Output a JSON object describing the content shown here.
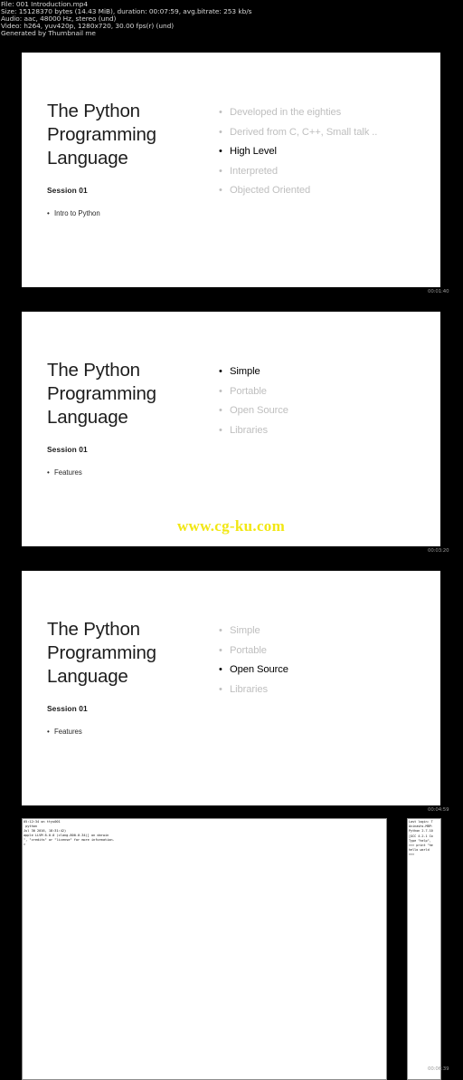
{
  "header": {
    "lines": [
      "File: 001 Introduction.mp4",
      "Size: 15128370 bytes (14.43 MiB), duration: 00:07:59, avg.bitrate: 253 kb/s",
      "Audio: aac, 48000 Hz, stereo (und)",
      "Video: h264, yuv420p, 1280x720, 30.00 fps(r) (und)",
      "Generated by Thumbnail me"
    ]
  },
  "thumbnails": [
    {
      "timestamp": "00:01:40",
      "title": "The Python Programming Language",
      "session": "Session 01",
      "subbullet": "Intro to Python",
      "bullets": [
        {
          "label": "Developed in the eighties",
          "active": false
        },
        {
          "label": "Derived from C, C++, Small talk ..",
          "active": false
        },
        {
          "label": "High Level",
          "active": true
        },
        {
          "label": "Interpreted",
          "active": false
        },
        {
          "label": "Objected Oriented",
          "active": false
        }
      ],
      "watermark": ""
    },
    {
      "timestamp": "00:03:20",
      "title": "The Python Programming Language",
      "session": "Session 01",
      "subbullet": "Features",
      "bullets": [
        {
          "label": "Simple",
          "active": true
        },
        {
          "label": "Portable",
          "active": false
        },
        {
          "label": "Open Source",
          "active": false
        },
        {
          "label": "Libraries",
          "active": false
        }
      ],
      "watermark": "www.cg-ku.com"
    },
    {
      "timestamp": "00:04:59",
      "title": "The Python Programming Language",
      "session": "Session 01",
      "subbullet": "Features",
      "bullets": [
        {
          "label": "Simple",
          "active": false
        },
        {
          "label": "Portable",
          "active": false
        },
        {
          "label": "Open Source",
          "active": true
        },
        {
          "label": "Libraries",
          "active": false
        }
      ],
      "watermark": ""
    }
  ],
  "terminal_thumbnail": {
    "timestamp": "00:06:39",
    "left_panel_text": "05:12:34 on ttys001\n python\nJul 30 2016, 18:31:42)\napple LLVM 8.0.0 (clang-800.0.34)] on darwin\n\", \"credits\" or \"license\" for more information.\n>",
    "right_panel_text": "Last login: T\nAvinashs-MBP:\nPython 2.7.10\n[GCC 4.2.1 Co\nType \"help\",\n>>> print \"he\nhello world\n>>>"
  }
}
